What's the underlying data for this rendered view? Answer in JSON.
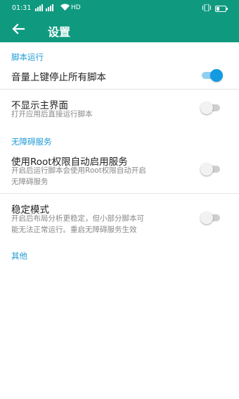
{
  "status_bar": {
    "time": "01:31",
    "network": "HD"
  },
  "header": {
    "title": "设置"
  },
  "sections": [
    {
      "header": "脚本运行"
    },
    {
      "header": "无障碍服务"
    },
    {
      "header": "其他"
    }
  ],
  "settings": [
    {
      "title": "音量上键停止所有脚本",
      "subtitle": "",
      "enabled": true
    },
    {
      "title": "不显示主界面",
      "subtitle": "打开应用后直接运行脚本",
      "enabled": false
    },
    {
      "title": "使用Root权限自动启用服务",
      "subtitle_lines": [
        "开启后运行脚本会使用Root权限自动开启",
        "无障碍服务"
      ],
      "enabled": false
    },
    {
      "title": "稳定模式",
      "subtitle_lines": [
        "开启后布局分析更稳定，但小部分脚本可",
        "能无法正常运行。重启无障碍服务生效"
      ],
      "enabled": false
    }
  ],
  "colors": {
    "app_bar": "#0f9a80",
    "section_header": "#1e9bd6",
    "switch_on": "#129be0"
  }
}
